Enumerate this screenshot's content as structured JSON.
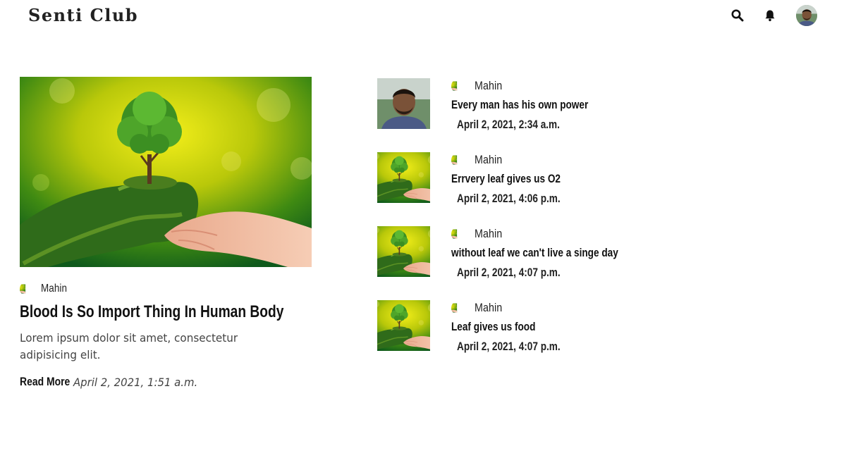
{
  "header": {
    "brand": "Senti Club",
    "icons": [
      "search-icon",
      "bell-icon",
      "user-avatar"
    ]
  },
  "featured": {
    "image": "tree-in-hands-image",
    "author": "Mahin",
    "title": "Blood Is So Import Thing In Human Body",
    "description": "Lorem ipsum dolor sit amet, consectetur adipisicing elit.",
    "read_more": "Read More",
    "date": "April 2, 2021, 1:51 a.m."
  },
  "posts": [
    {
      "author": "Mahin",
      "title": "Every man has his own power",
      "date": "April 2, 2021, 2:34 a.m.",
      "thumb": "person-portrait"
    },
    {
      "author": "Mahin",
      "title": "Errvery leaf gives us O2",
      "date": "April 2, 2021, 4:06 p.m.",
      "thumb": "tree-in-hands"
    },
    {
      "author": "Mahin",
      "title": "without leaf we can't live a singe day",
      "date": "April 2, 2021, 4:07 p.m.",
      "thumb": "tree-in-hands"
    },
    {
      "author": "Mahin",
      "title": "Leaf gives us food",
      "date": "April 2, 2021, 4:07 p.m.",
      "thumb": "tree-in-hands"
    }
  ]
}
